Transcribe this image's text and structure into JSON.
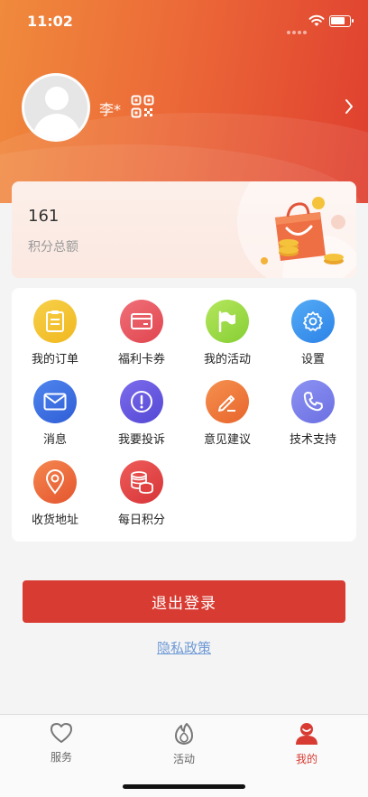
{
  "status_bar": {
    "time": "11:02"
  },
  "profile": {
    "name": "李*"
  },
  "points": {
    "value": "161",
    "label": "积分总额"
  },
  "menu": [
    {
      "label": "我的订单",
      "icon": "clipboard-icon",
      "color": "#f3c12c"
    },
    {
      "label": "福利卡券",
      "icon": "card-icon",
      "color": "#e95a62"
    },
    {
      "label": "我的活动",
      "icon": "flag-icon",
      "color": "#9fdb48"
    },
    {
      "label": "设置",
      "icon": "gear-icon",
      "color": "#3d98f0"
    },
    {
      "label": "消息",
      "icon": "envelope-icon",
      "color": "#3a6ae0"
    },
    {
      "label": "我要投诉",
      "icon": "exclamation-icon",
      "color": "#6b5be0"
    },
    {
      "label": "意见建议",
      "icon": "pencil-icon",
      "color": "#ef7b3e"
    },
    {
      "label": "技术支持",
      "icon": "phone-icon",
      "color": "#7d84ee"
    },
    {
      "label": "收货地址",
      "icon": "location-pin-icon",
      "color": "#ef6b3e"
    },
    {
      "label": "每日积分",
      "icon": "coin-stack-icon",
      "color": "#e4454a"
    }
  ],
  "actions": {
    "logout": "退出登录",
    "privacy": "隐私政策"
  },
  "tabs": [
    {
      "label": "服务",
      "icon": "heart-icon",
      "active": false
    },
    {
      "label": "活动",
      "icon": "flame-icon",
      "active": false
    },
    {
      "label": "我的",
      "icon": "user-icon",
      "active": true
    }
  ],
  "colors": {
    "accent": "#d83b32",
    "tab_active": "#d83b32",
    "tab_inactive": "#666666",
    "link": "#6f9ad6"
  }
}
